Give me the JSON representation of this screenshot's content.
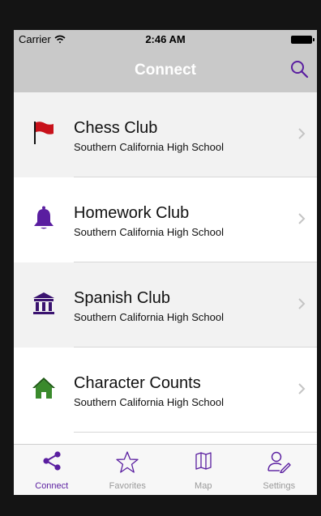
{
  "status_bar": {
    "carrier": "Carrier",
    "time": "2:46 AM"
  },
  "nav": {
    "title": "Connect"
  },
  "colors": {
    "accent": "#5a1ea0",
    "nav_bg": "#c9c9c9",
    "flag_red": "#c8121b",
    "house_green": "#3a8a2c"
  },
  "list": {
    "items": [
      {
        "title": "Chess Club",
        "subtitle": "Southern California High School",
        "icon": "flag-icon"
      },
      {
        "title": "Homework Club",
        "subtitle": "Southern California High School",
        "icon": "bell-icon"
      },
      {
        "title": "Spanish Club",
        "subtitle": "Southern California High School",
        "icon": "building-icon"
      },
      {
        "title": "Character Counts",
        "subtitle": "Southern California High School",
        "icon": "house-icon"
      }
    ]
  },
  "tabs": [
    {
      "label": "Connect",
      "icon": "share-icon",
      "active": true
    },
    {
      "label": "Favorites",
      "icon": "star-icon",
      "active": false
    },
    {
      "label": "Map",
      "icon": "map-icon",
      "active": false
    },
    {
      "label": "Settings",
      "icon": "user-pen-icon",
      "active": false
    }
  ]
}
